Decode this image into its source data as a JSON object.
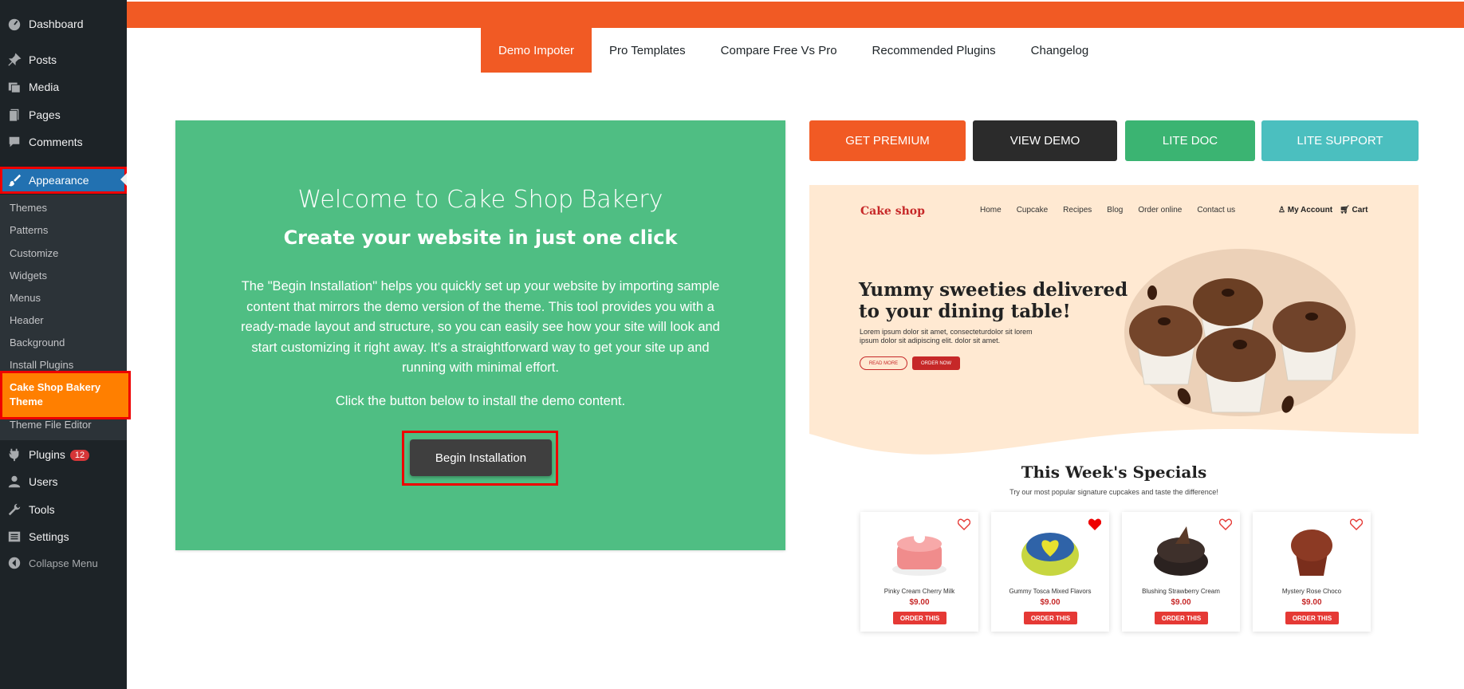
{
  "sidebar": {
    "dashboard": "Dashboard",
    "posts": "Posts",
    "media": "Media",
    "pages": "Pages",
    "comments": "Comments",
    "appearance": "Appearance",
    "submenu": [
      "Themes",
      "Patterns",
      "Customize",
      "Widgets",
      "Menus",
      "Header",
      "Background",
      "Install Plugins"
    ],
    "active_sub": "Cake Shop Bakery Theme",
    "theme_file_editor": "Theme File Editor",
    "plugins": "Plugins",
    "plugins_badge": "12",
    "users": "Users",
    "tools": "Tools",
    "settings": "Settings",
    "collapse": "Collapse Menu"
  },
  "tabs": [
    "Demo Impoter",
    "Pro Templates",
    "Compare Free Vs Pro",
    "Recommended Plugins",
    "Changelog"
  ],
  "welcome": {
    "title": "Welcome to Cake Shop Bakery",
    "subtitle": "Create your website in just one click",
    "description": "The \"Begin Installation\" helps you quickly set up your website by importing sample content that mirrors the demo version of the theme. This tool provides you with a ready-made layout and structure, so you can easily see how your site will look and start customizing it right away. It's a straightforward way to get your site up and running with minimal effort.",
    "click_note": "Click the button below to install the demo content.",
    "button": "Begin Installation"
  },
  "actions": {
    "get_premium": "GET PREMIUM",
    "view_demo": "VIEW DEMO",
    "lite_doc": "LITE DOC",
    "lite_support": "LITE SUPPORT"
  },
  "preview": {
    "logo": "Cake shop",
    "nav": [
      "Home",
      "Cupcake",
      "Recipes",
      "Blog",
      "Order online",
      "Contact us"
    ],
    "account": "My Account",
    "cart": "Cart",
    "headline": "Yummy sweeties delivered to your dining table!",
    "body": "Lorem ipsum dolor sit amet, consecteturdolor sit lorem ipsum dolor sit adipiscing elit. dolor sit amet.",
    "read_more": "READ MORE",
    "order_now": "ORDER NOW",
    "specials_title": "This Week's Specials",
    "specials_sub": "Try our most popular signature cupcakes and taste the difference!",
    "products": [
      {
        "name": "Pinky Cream Cherry Milk",
        "price": "$9.00",
        "button": "ORDER THIS"
      },
      {
        "name": "Gummy Tosca Mixed Flavors",
        "price": "$9.00",
        "button": "ORDER THIS"
      },
      {
        "name": "Blushing Strawberry Cream",
        "price": "$9.00",
        "button": "ORDER THIS"
      },
      {
        "name": "Mystery Rose Choco",
        "price": "$9.00",
        "button": "ORDER THIS"
      }
    ]
  },
  "colors": {
    "sidebar_bg": "#1d2327",
    "accent_orange": "#f15a24",
    "card_green": "#4fbe83",
    "active_blue": "#2271b1",
    "highlight_orange": "#ff7f00"
  }
}
